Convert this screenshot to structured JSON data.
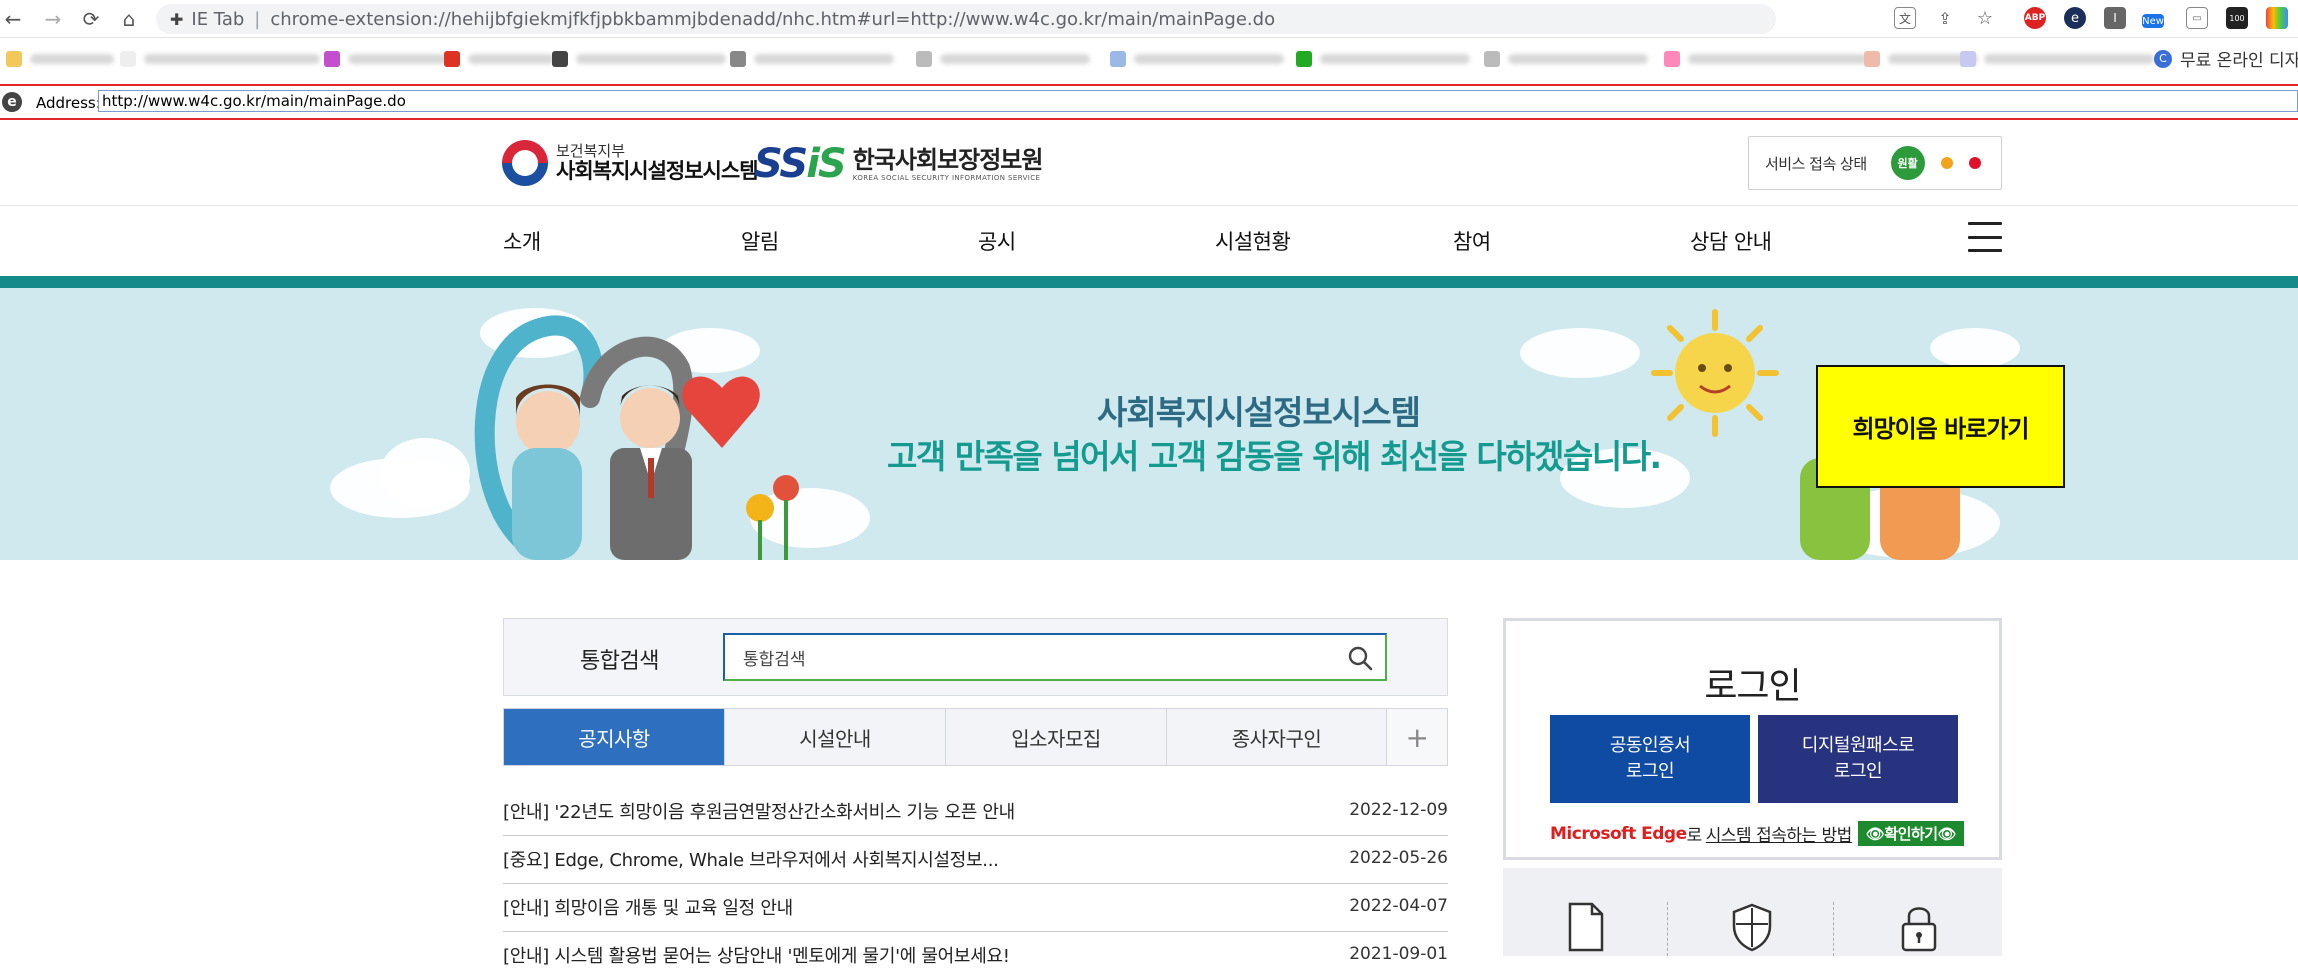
{
  "browser": {
    "nav": {
      "back": "←",
      "forward": "→",
      "reload": "⟳",
      "home": "⌂"
    },
    "omnibox": {
      "tab_name": "IE Tab",
      "separator": "|",
      "url": "chrome-extension://hehijbfgiekmjfkfjpbkbammjbdenadd/nhc.htm#url=http://www.w4c.go.kr/main/mainPage.do"
    },
    "extensions": [
      "translate-icon",
      "share-icon",
      "bookmark-star-icon",
      "abp-icon",
      "edge-like-icon",
      "i-icon",
      "new-badge-icon",
      "screen-icon",
      "100-icon",
      "grid-icon"
    ],
    "ext_labels": {
      "abp": "ABP",
      "new": "New",
      "hundred": "100",
      "info": "I"
    },
    "bookmark_last": "무료 온라인 디자",
    "ie_bar": {
      "label": "Address:",
      "url": "http://www.w4c.go.kr/main/mainPage.do"
    }
  },
  "header": {
    "mohw_small": "보건복지부",
    "mohw_big": "사회복지시설정보시스템",
    "ssis_mark_a": "SS",
    "ssis_mark_b": "iS",
    "ssis_kr": "한국사회보장정보원",
    "ssis_en": "KOREA SOCIAL SECURITY INFORMATION SERVICE",
    "status_label": "서비스 접속 상태",
    "status_value": "원활",
    "status_colors": {
      "good": "#2d9b3b",
      "mid": "#f4a21c",
      "bad": "#e0122b"
    }
  },
  "gnb": {
    "items": [
      "소개",
      "알림",
      "공시",
      "시설현황",
      "참여",
      "상담 안내"
    ]
  },
  "banner": {
    "title": "사회복지시설정보시스템",
    "subtitle": "고객 만족을 넘어서 고객 감동을 위해 최선을 다하겠습니다.",
    "hope_button": "희망이음 바로가기"
  },
  "search": {
    "label": "통합검색",
    "placeholder": "통합검색",
    "value": "통합검색"
  },
  "tabs": {
    "items": [
      "공지사항",
      "시설안내",
      "입소자모집",
      "종사자구인"
    ],
    "more": "+"
  },
  "notices": [
    {
      "title": "[안내] '22년도 희망이음 후원금연말정산간소화서비스 기능 오픈 안내",
      "date": "2022-12-09"
    },
    {
      "title": "[중요] Edge, Chrome, Whale 브라우저에서 사회복지시설정보...",
      "date": "2022-05-26"
    },
    {
      "title": "[안내] 희망이음 개통 및 교육 일정 안내",
      "date": "2022-04-07"
    },
    {
      "title": "[안내] 시스템 활용법 묻어는 상담안내 '멘토에게 물기'에 물어보세요!",
      "date": "2021-09-01"
    }
  ],
  "login": {
    "title": "로그인",
    "cert_line1": "공동인증서",
    "cert_line2": "로그인",
    "dpass_line1": "디지털원패스로",
    "dpass_line2": "로그인",
    "edge_text": "Microsoft Edge",
    "edge_rest": "로",
    "howto": "시스템 접속하는 방법",
    "check": "👁확인하기👁"
  },
  "quick_icons": [
    "document-icon",
    "shield-icon",
    "lock-icon"
  ]
}
